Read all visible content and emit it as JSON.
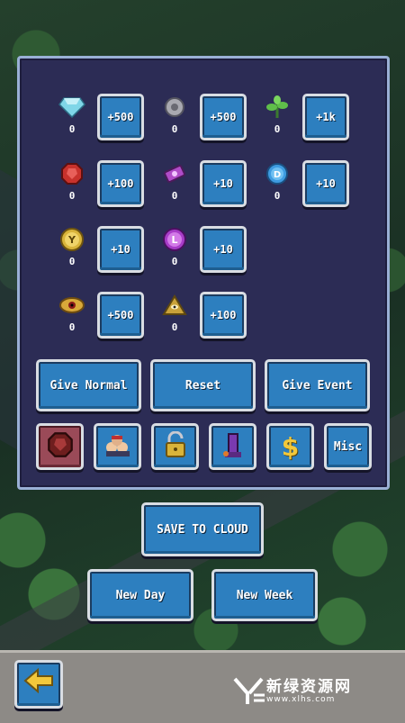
{
  "resources": [
    {
      "icon": "diamond-icon",
      "count": "0",
      "action": "+500"
    },
    {
      "icon": "silver-coin-icon",
      "count": "0",
      "action": "+500"
    },
    {
      "icon": "green-plant-icon",
      "count": "0",
      "action": "+1k"
    },
    {
      "icon": "red-gem-icon",
      "count": "0",
      "action": "+100"
    },
    {
      "icon": "purple-ticket-icon",
      "count": "0",
      "action": "+10"
    },
    {
      "icon": "d-coin-icon",
      "count": "0",
      "action": "+10"
    },
    {
      "icon": "y-coin-icon",
      "count": "0",
      "action": "+10"
    },
    {
      "icon": "l-coin-icon",
      "count": "0",
      "action": "+10"
    },
    {
      "icon": "eye-token-icon",
      "count": "0",
      "action": "+500"
    },
    {
      "icon": "pyramid-icon",
      "count": "0",
      "action": "+100"
    }
  ],
  "actions": {
    "give_normal": "Give Normal",
    "reset": "Reset",
    "give_event": "Give Event"
  },
  "tabs": {
    "misc": "Misc"
  },
  "footer": {
    "save": "SAVE TO CLOUD",
    "new_day": "New Day",
    "new_week": "New Week"
  },
  "watermark": {
    "title": "新绿资源网",
    "url": "www.xlhs.com"
  }
}
